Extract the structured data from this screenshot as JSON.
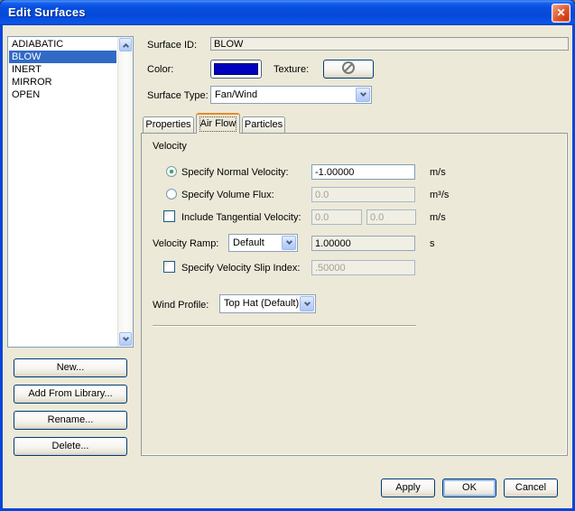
{
  "window": {
    "title": "Edit Surfaces",
    "close_glyph": "✕"
  },
  "surface_list": {
    "items": [
      {
        "label": "ADIABATIC",
        "selected": false
      },
      {
        "label": "BLOW",
        "selected": true
      },
      {
        "label": "INERT",
        "selected": false
      },
      {
        "label": "MIRROR",
        "selected": false
      },
      {
        "label": "OPEN",
        "selected": false
      }
    ]
  },
  "list_actions": {
    "new_label": "New...",
    "add_from_library_label": "Add From Library...",
    "rename_label": "Rename...",
    "delete_label": "Delete..."
  },
  "header_fields": {
    "surface_id_label": "Surface ID:",
    "surface_id_value": "BLOW",
    "color_label": "Color:",
    "color_value": "#0000BE",
    "texture_label": "Texture:",
    "surface_type_label": "Surface Type:",
    "surface_type_value": "Fan/Wind"
  },
  "tabs": {
    "properties": "Properties",
    "air_flow": "Air Flow",
    "particles": "Particles",
    "active": "Air Flow"
  },
  "air_flow_tab": {
    "group_title": "Velocity",
    "normal_velocity": {
      "label": "Specify Normal Velocity:",
      "value": "-1.00000",
      "unit": "m/s",
      "selected": true
    },
    "volume_flux": {
      "label": "Specify Volume Flux:",
      "value": "0.0",
      "unit": "m³/s",
      "selected": false
    },
    "tangential_velocity": {
      "label": "Include Tangential Velocity:",
      "value_1": "0.0",
      "value_2": "0.0",
      "unit": "m/s",
      "checked": false
    },
    "velocity_ramp": {
      "label": "Velocity Ramp:",
      "selected_option": "Default",
      "value": "1.00000",
      "unit": "s"
    },
    "slip_index": {
      "label": "Specify Velocity Slip Index:",
      "value": ".50000",
      "checked": false
    },
    "wind_profile": {
      "label": "Wind Profile:",
      "selected_option": "Top Hat (Default)"
    }
  },
  "dialog_actions": {
    "apply_label": "Apply",
    "ok_label": "OK",
    "cancel_label": "Cancel",
    "default_button": "OK"
  },
  "colors": {
    "selection": "#316AC5",
    "swatch": "#0000BE",
    "tab_highlight": "#E68B2C",
    "dialog_bg": "#ECE9D8",
    "title_bar": "#0848DA"
  }
}
